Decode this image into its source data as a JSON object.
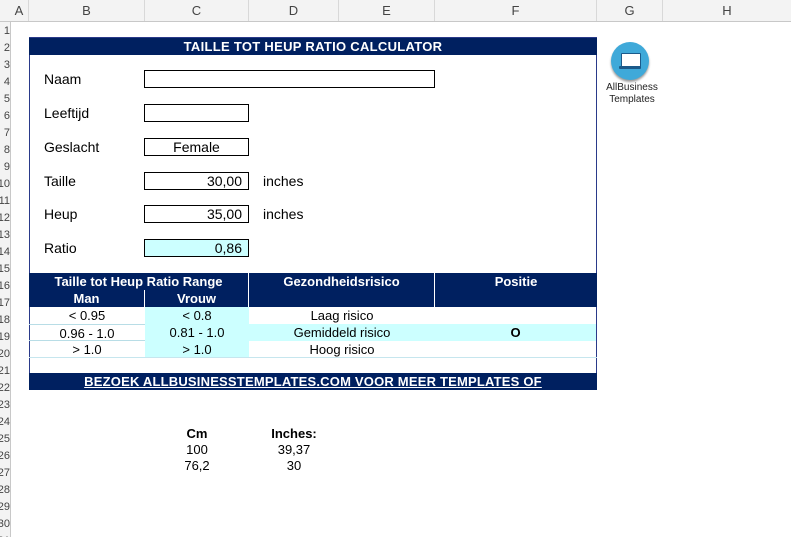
{
  "columns": [
    "A",
    "B",
    "C",
    "D",
    "E",
    "F",
    "G",
    "H"
  ],
  "rows": [
    "1",
    "2",
    "3",
    "4",
    "5",
    "6",
    "7",
    "8",
    "9",
    "10",
    "11",
    "12",
    "13",
    "14",
    "15",
    "16",
    "17",
    "18",
    "19",
    "20",
    "21",
    "22",
    "23",
    "24",
    "25",
    "26",
    "27",
    "28",
    "29",
    "30",
    "31"
  ],
  "calculator": {
    "title": "TAILLE TOT HEUP RATIO CALCULATOR",
    "name_label": "Naam",
    "name_value": "",
    "age_label": "Leeftijd",
    "age_value": "",
    "gender_label": "Geslacht",
    "gender_value": "Female",
    "waist_label": "Taille",
    "waist_value": "30,00",
    "waist_unit": "inches",
    "hip_label": "Heup",
    "hip_value": "35,00",
    "hip_unit": "inches",
    "ratio_label": "Ratio",
    "ratio_value": "0,86"
  },
  "range_table": {
    "header_range": "Taille tot Heup Ratio Range",
    "header_risk": "Gezondheidsrisico",
    "header_position": "Positie",
    "sub_man": "Man",
    "sub_woman": "Vrouw",
    "rows": [
      {
        "man": "< 0.95",
        "woman": "< 0.8",
        "risk": "Laag risico",
        "position": ""
      },
      {
        "man": "0.96 - 1.0",
        "woman": "0.81 - 1.0",
        "risk": "Gemiddeld risico",
        "position": "O"
      },
      {
        "man": "> 1.0",
        "woman": "> 1.0",
        "risk": "Hoog risico",
        "position": ""
      }
    ]
  },
  "footer_link": "BEZOEK ALLBUSINESSTEMPLATES.COM VOOR MEER TEMPLATES OF",
  "logo": {
    "line1": "AllBusiness",
    "line2": "Templates",
    "icon": "laptop-icon",
    "color": "#3fa9d9"
  },
  "conversion": {
    "header_cm": "Cm",
    "header_inches": "Inches:",
    "rows": [
      {
        "cm": "100",
        "inches": "39,37"
      },
      {
        "cm": "76,2",
        "inches": "30"
      }
    ]
  },
  "colors": {
    "navy": "#002060",
    "cyan": "#ccffff"
  }
}
